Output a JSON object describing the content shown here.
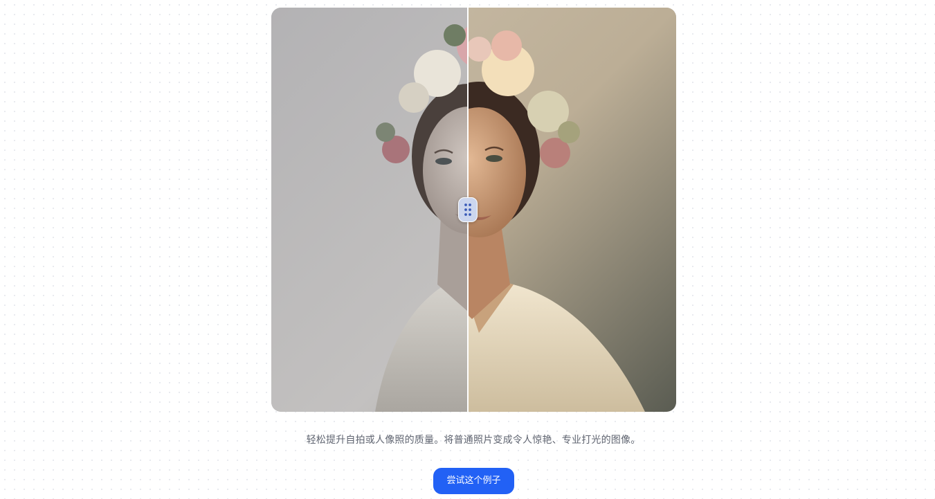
{
  "comparison": {
    "before_label": "",
    "after_label": "",
    "slider_position_percent": 48.5,
    "handle_icon": "drag-dots-icon"
  },
  "caption": "轻松提升自拍或人像照的质量。将普通照片变成令人惊艳、专业打光的图像。",
  "try_button_label": "尝试这个例子",
  "colors": {
    "accent": "#2261f5",
    "caption_text": "#5f6470",
    "handle_bg": "#ccd6ee",
    "handle_dots": "#3b5bb8"
  }
}
